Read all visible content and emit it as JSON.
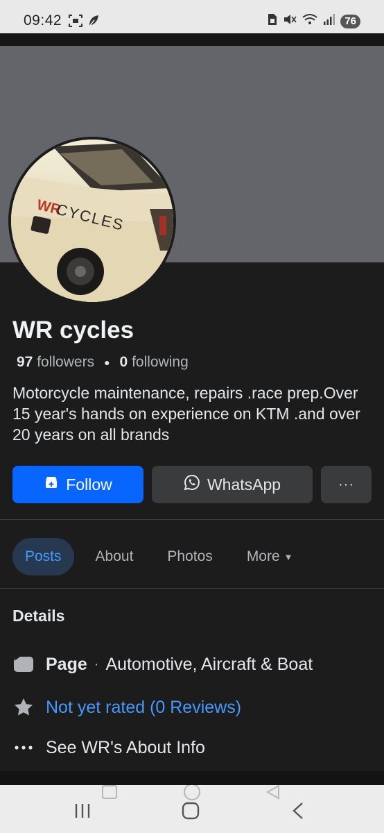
{
  "status_bar": {
    "time": "09:42",
    "battery": "76"
  },
  "profile": {
    "name": "WR cycles",
    "followers_count": "97",
    "followers_label": "followers",
    "following_count": "0",
    "following_label": "following",
    "bio": "Motorcycle maintenance, repairs .race prep.Over 15 year's hands on  experience on KTM .and over 20 years on all brands",
    "avatar_text": "WRCYCLES"
  },
  "actions": {
    "follow_label": "Follow",
    "whatsapp_label": "WhatsApp",
    "more_label": "···"
  },
  "tabs": [
    {
      "label": "Posts",
      "active": true
    },
    {
      "label": "About",
      "active": false
    },
    {
      "label": "Photos",
      "active": false
    },
    {
      "label": "More",
      "active": false
    }
  ],
  "details": {
    "title": "Details",
    "page_type_label": "Page",
    "category": "Automotive, Aircraft & Boat",
    "rating": "Not yet rated (0 Reviews)",
    "about_link": "See WR's About Info"
  },
  "colors": {
    "background": "#1c1c1d",
    "accent": "#0866ff",
    "link": "#4599ff",
    "active_tab_bg": "#263951"
  },
  "icons": [
    "screen-record-icon",
    "leaf-icon",
    "sim-icon",
    "mute-icon",
    "wifi-icon",
    "signal-icon",
    "follow-icon",
    "whatsapp-icon",
    "page-icon",
    "star-icon",
    "more-dots-icon",
    "recent-apps-icon",
    "home-icon",
    "back-icon"
  ]
}
